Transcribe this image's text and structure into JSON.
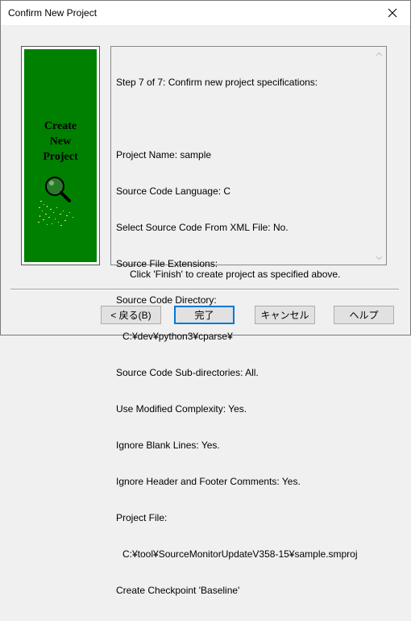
{
  "window": {
    "title": "Confirm New Project"
  },
  "side_panel": {
    "lines": [
      "Create",
      "New",
      "Project"
    ],
    "icon": "magnifier-icon",
    "background_color": "#008000"
  },
  "info": {
    "lines": [
      "Step 7 of 7: Confirm new project specifications:",
      "",
      "Project Name: sample",
      "Source Code Language: C",
      "Select Source Code From XML File: No.",
      "Source File Extensions:",
      "Source Code Directory:",
      "C:¥dev¥python3¥cparse¥",
      "Source Code Sub-directories: All.",
      "Use Modified Complexity: Yes.",
      "Ignore Blank Lines: Yes.",
      "Ignore Header and Footer Comments: Yes.",
      "Project File:",
      "C:¥tool¥SourceMonitorUpdateV358-15¥sample.smproj",
      "Create Checkpoint 'Baseline'"
    ]
  },
  "footer": {
    "note": "Click 'Finish' to create project as specified above."
  },
  "buttons": {
    "back": "< 戻る(B)",
    "finish": "完了",
    "cancel": "キャンセル",
    "help": "ヘルプ"
  }
}
